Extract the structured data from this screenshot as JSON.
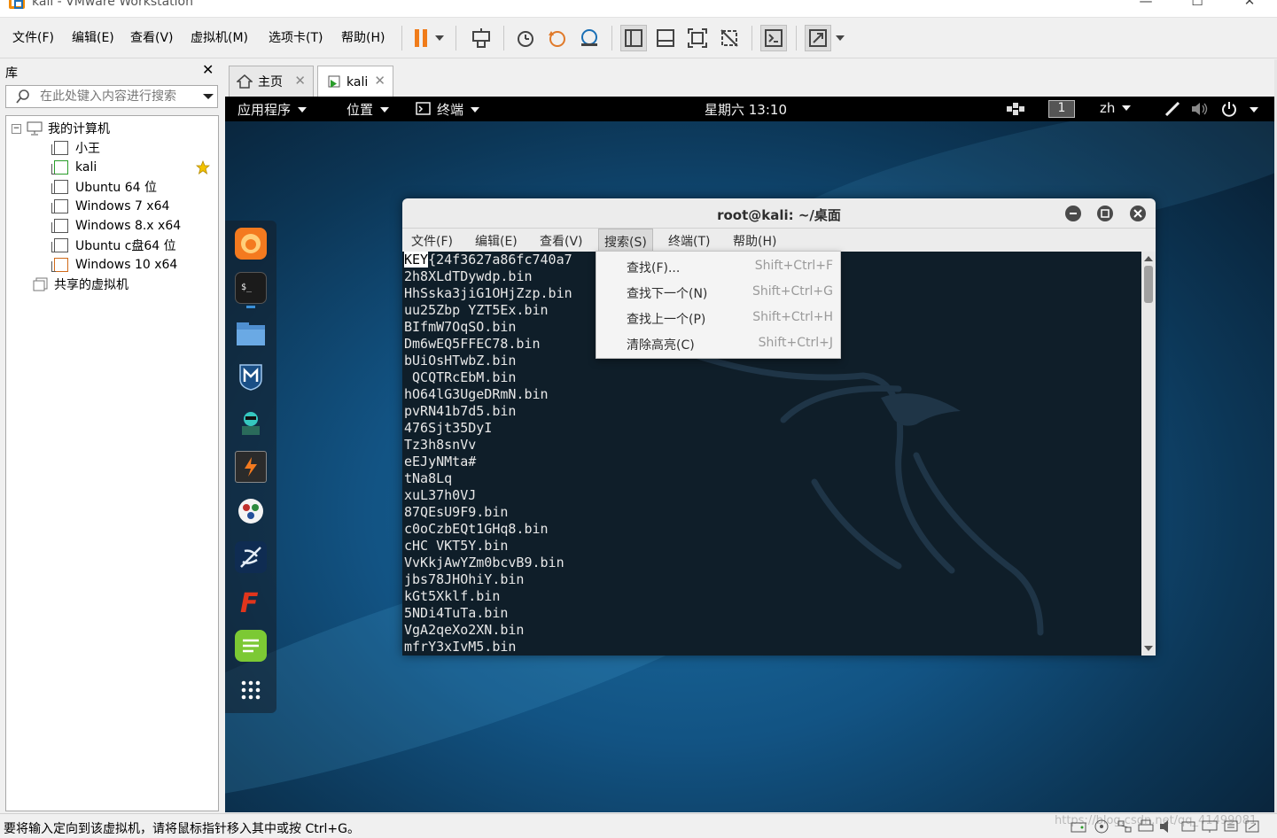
{
  "window": {
    "title": "kali - VMware Workstation",
    "min": "—",
    "max": "☐",
    "close": "✕"
  },
  "menubar": {
    "items": [
      "文件(F)",
      "编辑(E)",
      "查看(V)",
      "虚拟机(M)",
      "选项卡(T)",
      "帮助(H)"
    ]
  },
  "library": {
    "title": "库",
    "close": "✕",
    "search_placeholder": "在此处键入内容进行搜索",
    "tree": {
      "root": "我的计算机",
      "vms": [
        "小王",
        "kali",
        "Ubuntu 64 位",
        "Windows 7 x64",
        "Windows 8.x x64",
        "Ubuntu c盘64 位",
        "Windows 10 x64"
      ],
      "shared": "共享的虚拟机"
    }
  },
  "tabs": [
    {
      "label": "主页",
      "close": "✕"
    },
    {
      "label": "kali",
      "close": "✕"
    }
  ],
  "gnome": {
    "apps": "应用程序",
    "places": "位置",
    "terminal": "终端",
    "clock": "星期六 13:10",
    "workspace": "1",
    "lang": "zh"
  },
  "terminal": {
    "title": "root@kali: ~/桌面",
    "menu": [
      "文件(F)",
      "编辑(E)",
      "查看(V)",
      "搜索(S)",
      "终端(T)",
      "帮助(H)"
    ],
    "lines": [
      "{24f3627a86fc740a7",
      "2h8XLdTDywdp.bin",
      "HhSska3jiG1OHjZzp.bin",
      "uu25Zbp YZT5Ex.bin",
      "BIfmW7OqSO.bin",
      "Dm6wEQ5FFEC78.bin",
      "bUiOsHTwbZ.bin",
      " QCQTRcEbM.bin",
      "hO64lG3UgeDRmN.bin",
      "pvRN41b7d5.bin",
      "476Sjt35DyI",
      "Tz3h8snVv",
      "eEJyNMta#",
      "tNa8Lq",
      "xuL37h0VJ",
      "87QEsU9F9.bin",
      "c0oCzbEQt1GHq8.bin",
      "cHC VKT5Y.bin",
      "VvKkjAwYZm0bcvB9.bin",
      "jbs78JHOhiY.bin",
      "kGt5Xklf.bin",
      "5NDi4TuTa.bin",
      "VgA2qeXo2XN.bin",
      "mfrY3xIvM5.bin"
    ],
    "first_highlight": "KEY"
  },
  "search_menu": [
    {
      "label": "查找(F)...",
      "shortcut": "Shift+Ctrl+F"
    },
    {
      "label": "查找下一个(N)",
      "shortcut": "Shift+Ctrl+G"
    },
    {
      "label": "查找上一个(P)",
      "shortcut": "Shift+Ctrl+H"
    },
    {
      "label": "清除高亮(C)",
      "shortcut": "Shift+Ctrl+J"
    }
  ],
  "statusbar": {
    "text": "要将输入定向到该虚拟机，请将鼠标指针移入其中或按 Ctrl+G。",
    "watermark": "https://blog.csdn.net/qq_41499081"
  },
  "colors": {
    "accent_orange": "#f28a00",
    "pause_orange": "#f07c1a",
    "vm_blue": "#125383",
    "terminal_bg": "#0f1e29"
  }
}
